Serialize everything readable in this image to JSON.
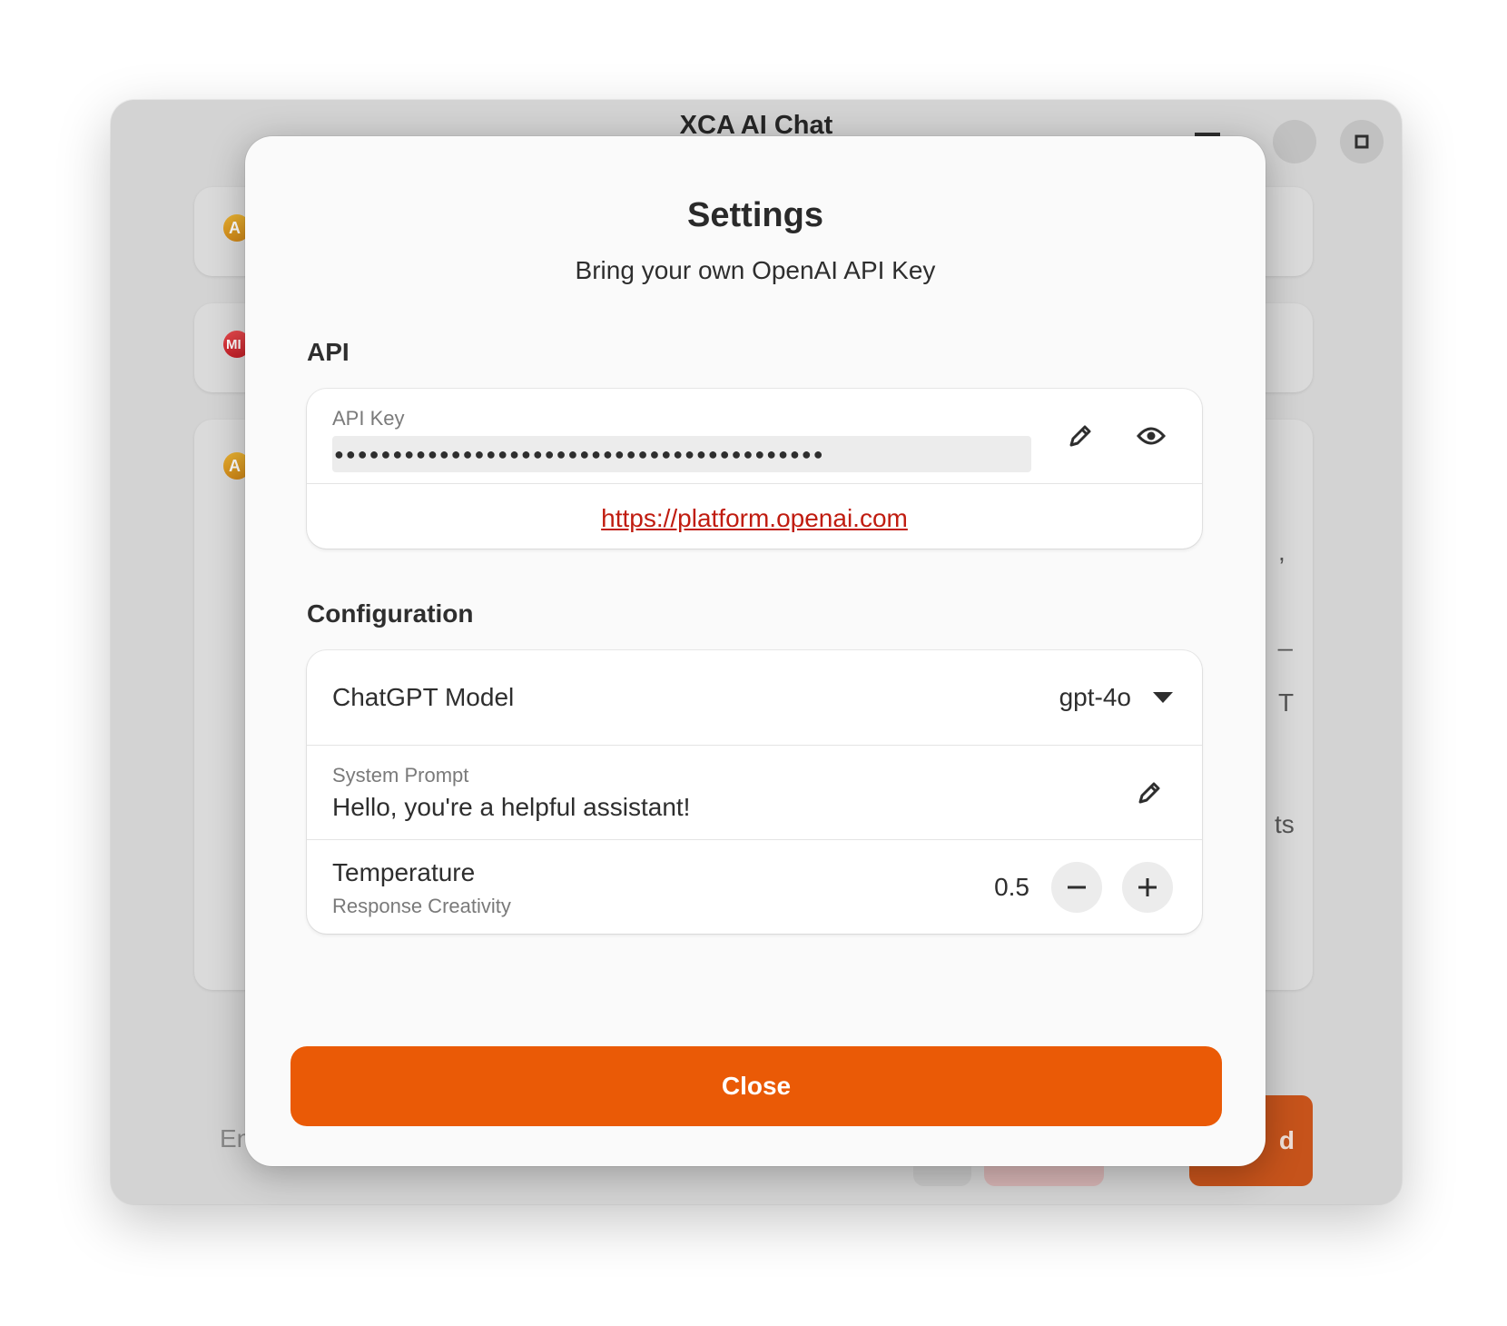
{
  "window": {
    "title": "XCA AI Chat",
    "avatars": [
      "A",
      "MI",
      "A"
    ],
    "input_hint": "En",
    "send_fragment": "d",
    "text_fragments": [
      ",",
      "_",
      "T",
      "ts"
    ]
  },
  "dialog": {
    "title": "Settings",
    "subtitle": "Bring your own OpenAI API Key",
    "api": {
      "heading": "API",
      "key_label": "API Key",
      "key_value": "●●●●●●●●●●●●●●●●●●●●●●●●●●●●●●●●●●●●●●●●●●",
      "link": "https://platform.openai.com"
    },
    "configuration": {
      "heading": "Configuration",
      "model_label": "ChatGPT Model",
      "model_value": "gpt-4o",
      "prompt_label": "System Prompt",
      "prompt_value": "Hello, you're a helpful assistant!",
      "temperature_label": "Temperature",
      "temperature_sublabel": "Response Creativity",
      "temperature_value": "0.5"
    },
    "close_label": "Close"
  },
  "colors": {
    "accent": "#ea5a06",
    "link": "#c01c10",
    "avatar_orange": "#e09a1c",
    "avatar_red": "#d9303a"
  },
  "icons": [
    "minimize-icon",
    "maximize-icon",
    "close-icon",
    "edit-icon",
    "eye-icon",
    "dropdown-arrow-icon",
    "minus-icon",
    "plus-icon"
  ]
}
